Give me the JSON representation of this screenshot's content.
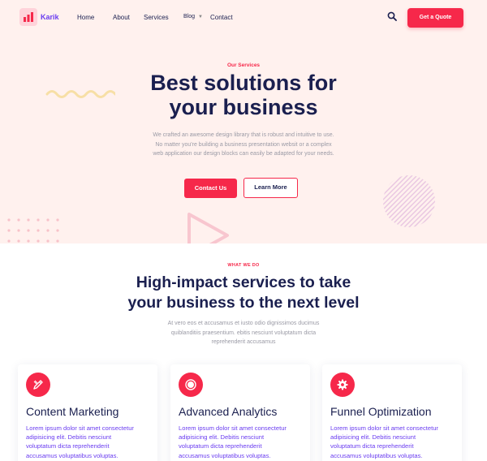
{
  "nav": {
    "brand": "Karik",
    "links": [
      "Home",
      "About",
      "Services",
      "Blog",
      "Contact"
    ],
    "quote_label": "Get a Quote"
  },
  "hero": {
    "eyebrow": "Our Services",
    "title_line1": "Best solutions for",
    "title_line2": "your business",
    "subtitle_line1": "We crafted an awesome design library that is robust and intuitive to use.",
    "subtitle_line2": "No matter you're building a business presentation websit or a complex",
    "subtitle_line3": "web application our design blocks can easily be adapted for your needs.",
    "contact_label": "Contact Us",
    "learn_label": "Learn More"
  },
  "services": {
    "eyebrow": "WHAT WE DO",
    "title_line1": "High-impact services to take",
    "title_line2": "your business to the next level",
    "subtitle_line1": "At vero eos et accusamus et iusto odio dignissimos ducimus",
    "subtitle_line2": "quiblanditiis praesentium. ebitis nesciunt voluptatum dicta",
    "subtitle_line3": "reprehenderit accusamus",
    "cards": [
      {
        "title": "Content Marketing",
        "lines": [
          "Lorem ipsum dolor sit amet consectetur",
          "adipisicing elit. Debitis nesciunt",
          "voluptatum dicta reprehenderit",
          "accusamus voluptatibus voluptas."
        ]
      },
      {
        "title": "Advanced Analytics",
        "lines": [
          "Lorem ipsum dolor sit amet consectetur",
          "adipisicing elit. Debitis nesciunt",
          "voluptatum dicta reprehenderit",
          "accusamus voluptatibus voluptas."
        ]
      },
      {
        "title": "Funnel Optimization",
        "lines": [
          "Lorem ipsum dolor sit amet consectetur",
          "adipisicing elit. Debitis nesciunt",
          "voluptatum dicta reprehenderit",
          "accusamus voluptatibus voluptas."
        ]
      }
    ]
  },
  "colors": {
    "accent": "#f6284a",
    "navy": "#1a1f4f",
    "brand_purple": "#6a3df0",
    "hero_bg": "#fff1ee"
  },
  "icons": {
    "logo": "bar-chart-logo-icon",
    "search": "search-icon",
    "blog_dropdown": "chevron-down-icon",
    "card1": "pen-ruler-icon",
    "card2": "target-circle-icon",
    "card3": "gear-icon"
  }
}
